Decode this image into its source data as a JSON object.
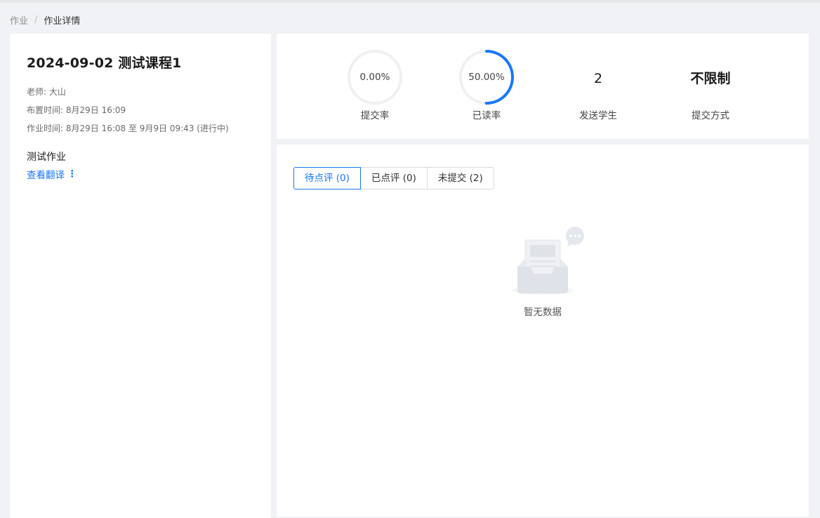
{
  "breadcrumb": {
    "parent": "作业",
    "separator": "/",
    "current": "作业详情"
  },
  "homework": {
    "title": "2024-09-02 测试课程1",
    "teacher": "老师: 大山",
    "assigned_time": "布置时间: 8月29日 16:09",
    "work_time": "作业时间: 8月29日 16:08 至 9月9日 09:43 (进行中)",
    "name": "测试作业",
    "translate_link": "查看翻译",
    "more_icon": "⋮"
  },
  "stats": {
    "submit_rate": {
      "value": "0.00%",
      "fraction": 0.0,
      "label": "提交率"
    },
    "read_rate": {
      "value": "50.00%",
      "fraction": 0.5,
      "label": "已读率"
    },
    "students_sent": {
      "value": "2",
      "label": "发送学生"
    },
    "submit_method": {
      "value": "不限制",
      "label": "提交方式"
    }
  },
  "tabs": [
    {
      "label": "待点评 (0)",
      "active": true
    },
    {
      "label": "已点评 (0)",
      "active": false
    },
    {
      "label": "未提交 (2)",
      "active": false
    }
  ],
  "empty": {
    "text": "暂无数据",
    "icon": "empty-inbox-icon"
  },
  "colors": {
    "accent": "#1677ff",
    "track": "#f0f0f0"
  }
}
